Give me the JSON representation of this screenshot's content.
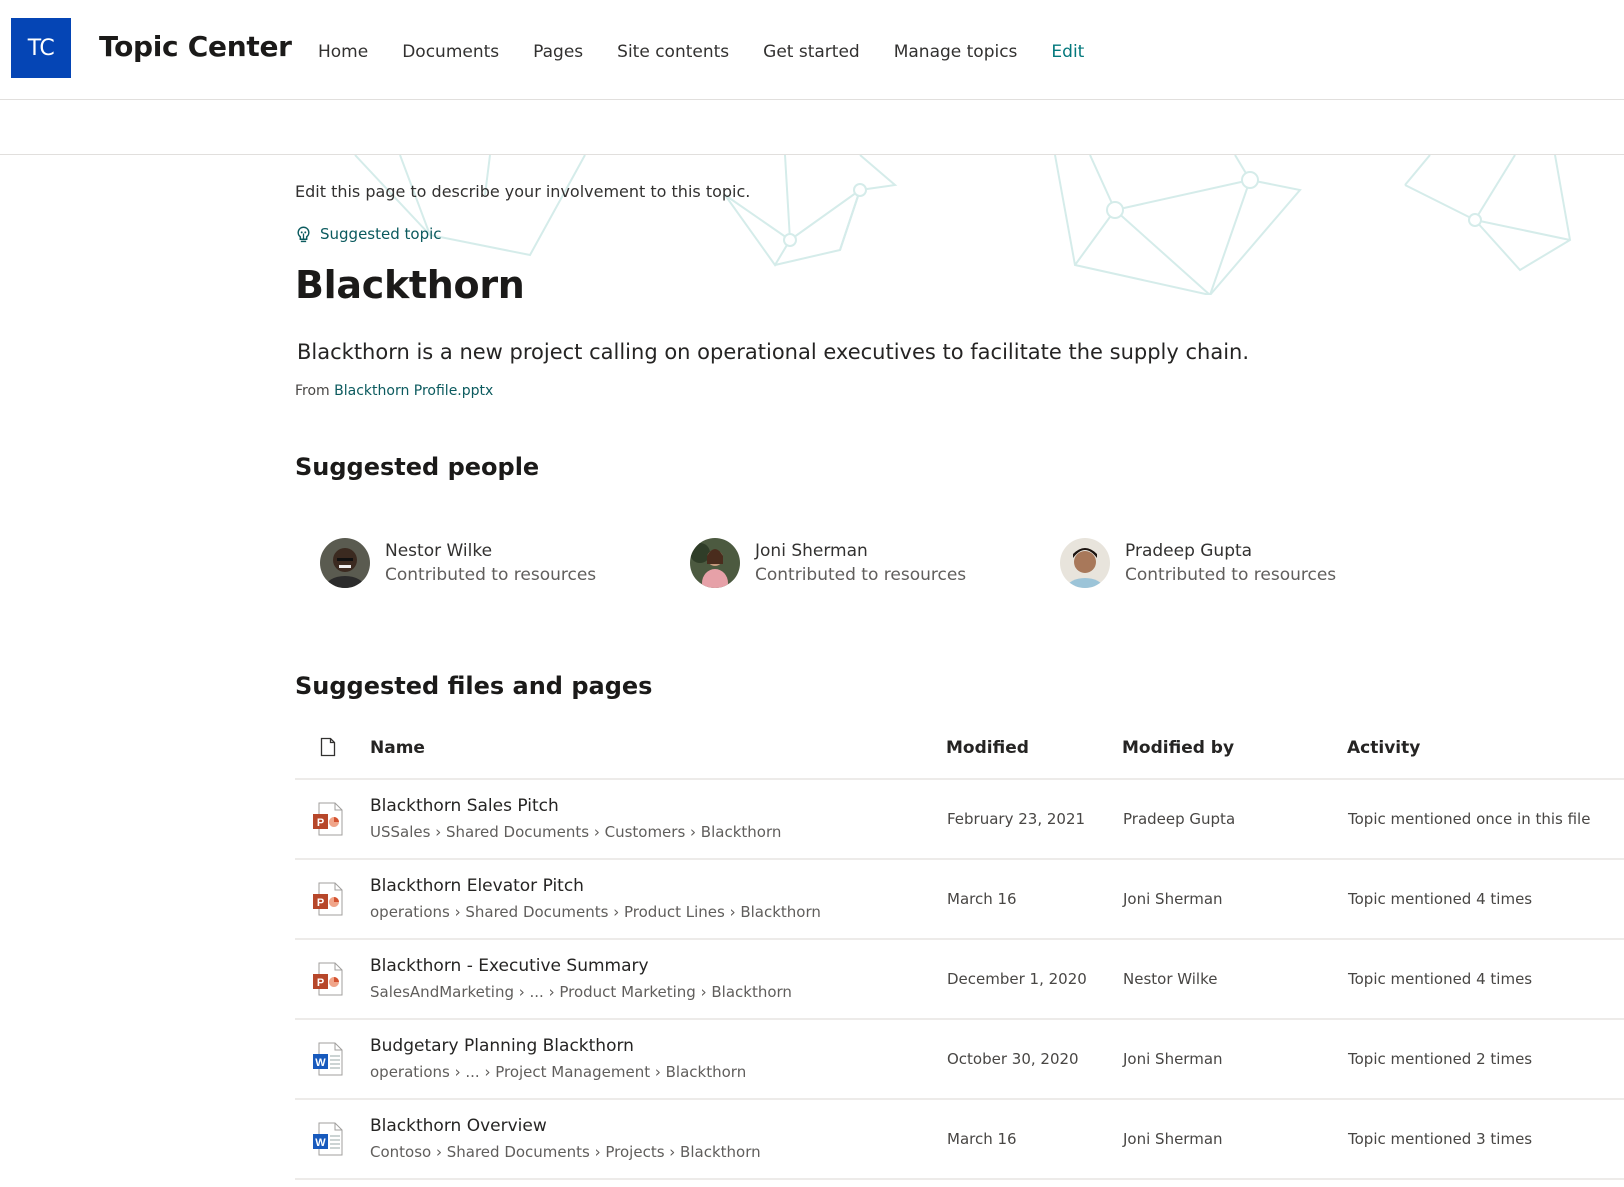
{
  "header": {
    "logo_initials": "TC",
    "site_title": "Topic Center",
    "nav": [
      {
        "label": "Home"
      },
      {
        "label": "Documents"
      },
      {
        "label": "Pages"
      },
      {
        "label": "Site contents"
      },
      {
        "label": "Get started"
      },
      {
        "label": "Manage topics"
      },
      {
        "label": "Edit"
      }
    ]
  },
  "topic": {
    "intro": "Edit this page to describe your involvement to this topic.",
    "badge_label": "Suggested topic",
    "badge_icon": "lightbulb-icon",
    "title": "Blackthorn",
    "description": "Blackthorn is a new project calling on operational executives to facilitate the supply chain.",
    "source_prefix": "From",
    "source_link": "Blackthorn Profile.pptx"
  },
  "people": {
    "heading": "Suggested people",
    "items": [
      {
        "name": "Nestor Wilke",
        "role": "Contributed to resources"
      },
      {
        "name": "Joni Sherman",
        "role": "Contributed to resources"
      },
      {
        "name": "Pradeep Gupta",
        "role": "Contributed to resources"
      }
    ]
  },
  "files": {
    "heading": "Suggested files and pages",
    "columns": {
      "icon": "file-type-icon",
      "name": "Name",
      "modified": "Modified",
      "modified_by": "Modified by",
      "activity": "Activity"
    },
    "rows": [
      {
        "type": "pptx",
        "name": "Blackthorn Sales Pitch",
        "path": "USSales › Shared Documents › Customers › Blackthorn",
        "modified": "February 23, 2021",
        "modified_by": "Pradeep Gupta",
        "activity": "Topic mentioned once in this file"
      },
      {
        "type": "pptx",
        "name": "Blackthorn Elevator Pitch",
        "path": "operations › Shared Documents › Product Lines › Blackthorn",
        "modified": "March 16",
        "modified_by": "Joni Sherman",
        "activity": "Topic mentioned 4 times"
      },
      {
        "type": "pptx",
        "name": "Blackthorn - Executive Summary",
        "path": "SalesAndMarketing › ... › Product Marketing › Blackthorn",
        "modified": "December 1, 2020",
        "modified_by": "Nestor Wilke",
        "activity": "Topic mentioned 4 times"
      },
      {
        "type": "docx",
        "name": "Budgetary Planning Blackthorn",
        "path": "operations › ... › Project Management › Blackthorn",
        "modified": "October 30, 2020",
        "modified_by": "Joni Sherman",
        "activity": "Topic mentioned 2 times"
      },
      {
        "type": "docx",
        "name": "Blackthorn Overview",
        "path": "Contoso › Shared Documents › Projects › Blackthorn",
        "modified": "March 16",
        "modified_by": "Joni Sherman",
        "activity": "Topic mentioned 3 times"
      }
    ]
  },
  "colors": {
    "brand": "#0545b5",
    "accent_teal": "#03787c",
    "pptx": "#b7472a",
    "docx": "#185abd",
    "background_pattern": "#d5ecea"
  }
}
